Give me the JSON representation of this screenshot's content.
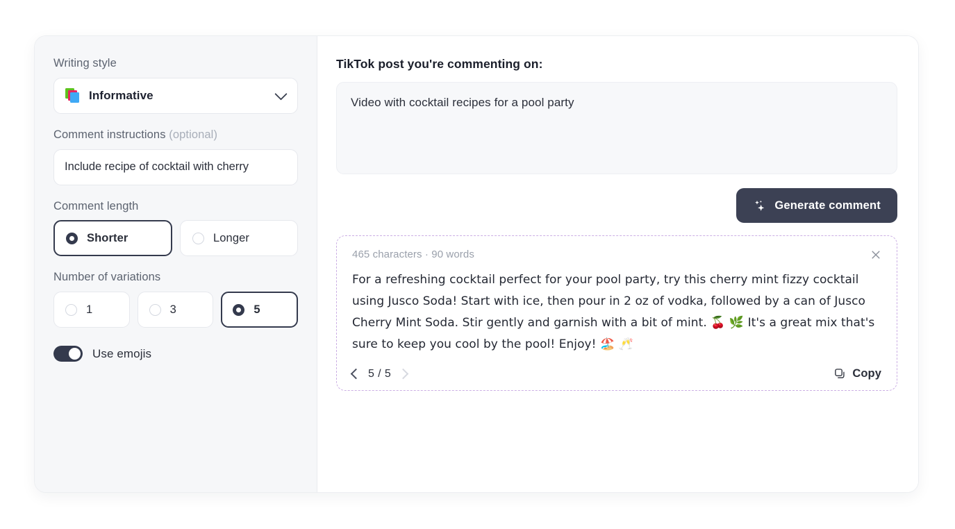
{
  "settings": {
    "writing_style": {
      "label": "Writing style",
      "icon": "books-emoji",
      "value": "Informative",
      "chevron": "chevron-down-icon"
    },
    "instructions": {
      "label": "Comment instructions",
      "label_optional": " (optional)",
      "value": "Include recipe of cocktail with cherry",
      "placeholder": "Include recipe of cocktail with cherry"
    },
    "comment_length": {
      "label": "Comment length",
      "options": [
        {
          "label": "Shorter",
          "selected": true
        },
        {
          "label": "Longer",
          "selected": false
        }
      ]
    },
    "variations": {
      "label": "Number of variations",
      "options": [
        {
          "label": "1",
          "selected": false
        },
        {
          "label": "3",
          "selected": false
        },
        {
          "label": "5",
          "selected": true
        }
      ]
    },
    "use_emojis": {
      "label": "Use emojis",
      "enabled": true
    }
  },
  "main": {
    "title": "TikTok post you're commenting on:",
    "post_value": "Video with cocktail recipes for a pool party",
    "post_placeholder": "Video with cocktail recipes for a pool party",
    "generate_button": {
      "label": "Generate comment",
      "icon": "sparkles-icon"
    },
    "result": {
      "meta": "465 characters · 90 words",
      "close_icon": "close-icon",
      "text": "For a refreshing cocktail perfect for your pool party, try this cherry mint fizzy cocktail using Jusco Soda! Start with ice, then pour in 2 oz of vodka, followed by a can of Jusco Cherry Mint Soda. Stir gently and garnish with a bit of mint. 🍒 🌿 It's a great mix that's sure to keep you cool by the pool! Enjoy! 🏖️ 🥂",
      "pager": {
        "prev_icon": "chevron-left-icon",
        "next_icon": "chevron-right-icon",
        "count": "5 / 5",
        "current": 5,
        "total": 5
      },
      "copy_button": {
        "label": "Copy",
        "icon": "copy-icon"
      }
    }
  },
  "colors": {
    "accent_dark": "#3c4154",
    "result_border": "#cbaee4",
    "panel_bg": "#f6f7f9",
    "post_bg": "#f7f8fa",
    "muted_text": "#9aa0ab"
  }
}
